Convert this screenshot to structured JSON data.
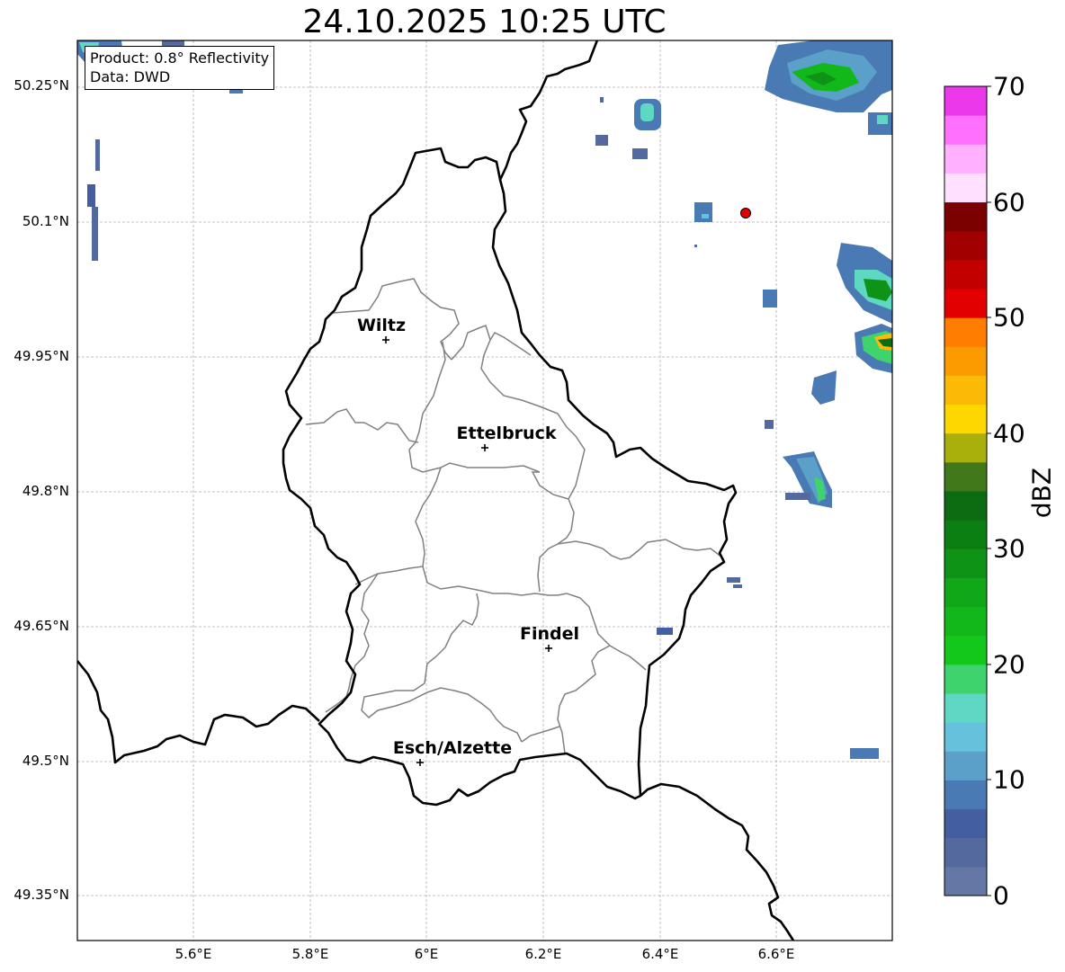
{
  "title": "24.10.2025 10:25 UTC",
  "info_box": {
    "product": "Product: 0.8° Reflectivity",
    "source": "Data: DWD"
  },
  "lat_labels": [
    "50.25°N",
    "50.1°N",
    "49.95°N",
    "49.8°N",
    "49.65°N",
    "49.5°N",
    "49.35°N"
  ],
  "lon_labels": [
    "5.6°E",
    "5.8°E",
    "6°E",
    "6.2°E",
    "6.4°E",
    "6.6°E"
  ],
  "cities": [
    "Wiltz",
    "Ettelbruck",
    "Findel",
    "Esch/Alzette"
  ],
  "colorbar": {
    "label": "dBZ",
    "ticks": [
      "70",
      "60",
      "50",
      "40",
      "30",
      "20",
      "10",
      "0"
    ],
    "colors": [
      "#6477a5",
      "#546a9e",
      "#445fa1",
      "#4a7ab3",
      "#5aa0c8",
      "#66c2dc",
      "#5fd8c3",
      "#3ed36c",
      "#14c81b",
      "#12b81a",
      "#10a818",
      "#0f9316",
      "#0c7f13",
      "#0b6c12",
      "#41781a",
      "#a9b00b",
      "#fed701",
      "#fcb905",
      "#fc9b00",
      "#ff7d00",
      "#e30000",
      "#c20000",
      "#a00000",
      "#7b0000",
      "#ffe0ff",
      "#ffb0ff",
      "#ff70ff",
      "#eb38eb"
    ]
  },
  "colors": {
    "country_border": "#000000",
    "canton_border": "#808080",
    "grid": "#b0b0b0",
    "marker": "#e00000"
  }
}
